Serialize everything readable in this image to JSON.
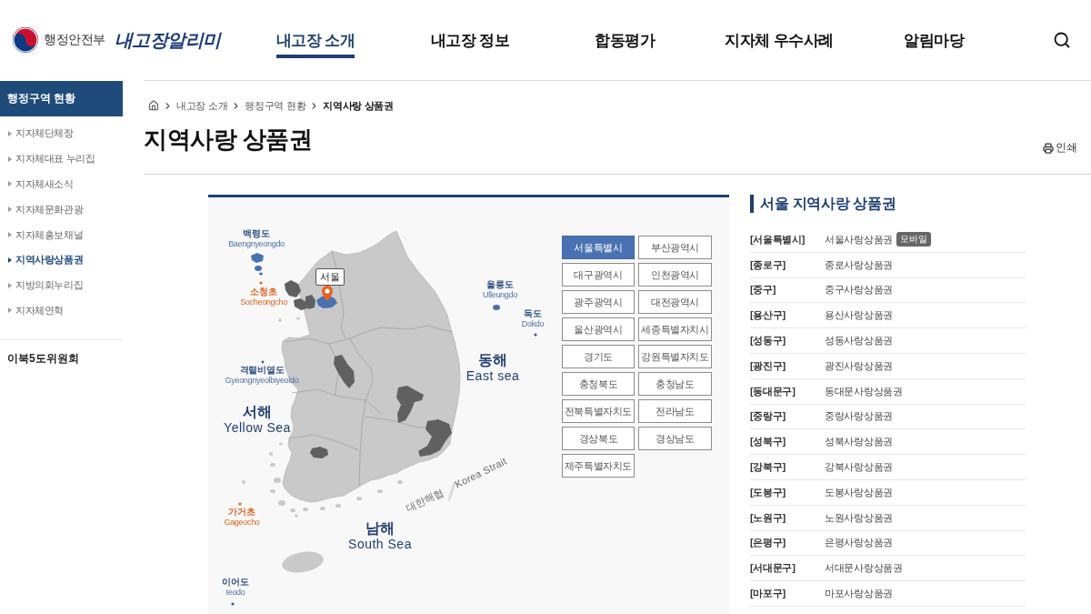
{
  "header": {
    "ministry": "행정안전부",
    "site_name": "내고장알리미",
    "nav": [
      {
        "label": "내고장 소개",
        "selected": true
      },
      {
        "label": "내고장 정보",
        "selected": false
      },
      {
        "label": "합동평가",
        "selected": false
      },
      {
        "label": "지자체 우수사례",
        "selected": false
      },
      {
        "label": "알림마당",
        "selected": false
      }
    ]
  },
  "sidebar": {
    "title": "행정구역 현황",
    "items": [
      {
        "label": "지자체단체장",
        "selected": false
      },
      {
        "label": "지자체대표 누리집",
        "selected": false
      },
      {
        "label": "지자체새소식",
        "selected": false
      },
      {
        "label": "지자체문화관광",
        "selected": false
      },
      {
        "label": "지자체홍보채널",
        "selected": false
      },
      {
        "label": "지역사랑상품권",
        "selected": true
      },
      {
        "label": "지방의회누리집",
        "selected": false
      },
      {
        "label": "지자체연혁",
        "selected": false
      }
    ],
    "footer_link": "이북5도위원회"
  },
  "breadcrumb": [
    {
      "label": "내고장 소개",
      "current": false
    },
    {
      "label": "행정구역 현황",
      "current": false
    },
    {
      "label": "지역사랑 상품권",
      "current": true
    }
  ],
  "page_title": "지역사랑 상품권",
  "print_label": "인쇄",
  "map": {
    "callout": "서울",
    "labels": [
      {
        "kind": "island",
        "ko": "백령도",
        "en": "Baengnyeongdo"
      },
      {
        "kind": "reef",
        "ko": "소청초",
        "en": "Socheongcho"
      },
      {
        "kind": "island",
        "ko": "울릉도",
        "en": "Ulleungdo"
      },
      {
        "kind": "island",
        "ko": "독도",
        "en": "Dokdo"
      },
      {
        "kind": "island",
        "ko": "격렬비열도",
        "en": "Gyeongnyeolbiyeoldo"
      },
      {
        "kind": "sea",
        "ko": "동해",
        "en": "East sea"
      },
      {
        "kind": "sea",
        "ko": "서해",
        "en": "Yellow Sea"
      },
      {
        "kind": "strait",
        "ko": "대한해협",
        "en": "Korea Strait"
      },
      {
        "kind": "reef",
        "ko": "가거초",
        "en": "Gageocho"
      },
      {
        "kind": "sea",
        "ko": "남해",
        "en": "South Sea"
      },
      {
        "kind": "island",
        "ko": "이어도",
        "en": "Ieodo"
      }
    ]
  },
  "regions": [
    {
      "label": "서울특별시",
      "selected": true
    },
    {
      "label": "부산광역시",
      "selected": false
    },
    {
      "label": "대구광역시",
      "selected": false
    },
    {
      "label": "인천광역시",
      "selected": false
    },
    {
      "label": "광주광역시",
      "selected": false
    },
    {
      "label": "대전광역시",
      "selected": false
    },
    {
      "label": "울산광역시",
      "selected": false
    },
    {
      "label": "세종특별자치시",
      "selected": false
    },
    {
      "label": "경기도",
      "selected": false
    },
    {
      "label": "강원특별자치도",
      "selected": false
    },
    {
      "label": "충청북도",
      "selected": false
    },
    {
      "label": "충청남도",
      "selected": false
    },
    {
      "label": "전북특별자치도",
      "selected": false
    },
    {
      "label": "전라남도",
      "selected": false
    },
    {
      "label": "경상북도",
      "selected": false
    },
    {
      "label": "경상남도",
      "selected": false
    },
    {
      "label": "제주특별자치도",
      "selected": false
    }
  ],
  "vouchers": {
    "title": "서울 지역사랑 상품권",
    "rows": [
      {
        "area": "[서울특별시]",
        "name": "서울사랑상품권",
        "badge": "모바일"
      },
      {
        "area": "[종로구]",
        "name": "종로사랑상품권"
      },
      {
        "area": "[중구]",
        "name": "중구사랑상품권"
      },
      {
        "area": "[용산구]",
        "name": "용산사랑상품권"
      },
      {
        "area": "[성동구]",
        "name": "성동사랑상품권"
      },
      {
        "area": "[광진구]",
        "name": "광진사랑상품권"
      },
      {
        "area": "[동대문구]",
        "name": "동대문사랑상품권"
      },
      {
        "area": "[중랑구]",
        "name": "중랑사랑상품권"
      },
      {
        "area": "[성북구]",
        "name": "성북사랑상품권"
      },
      {
        "area": "[강북구]",
        "name": "강북사랑상품권"
      },
      {
        "area": "[도봉구]",
        "name": "도봉사랑상품권"
      },
      {
        "area": "[노원구]",
        "name": "노원사랑상품권"
      },
      {
        "area": "[은평구]",
        "name": "은평사랑상품권"
      },
      {
        "area": "[서대문구]",
        "name": "서대문사랑상품권"
      },
      {
        "area": "[마포구]",
        "name": "마포사랑상품권"
      }
    ]
  }
}
